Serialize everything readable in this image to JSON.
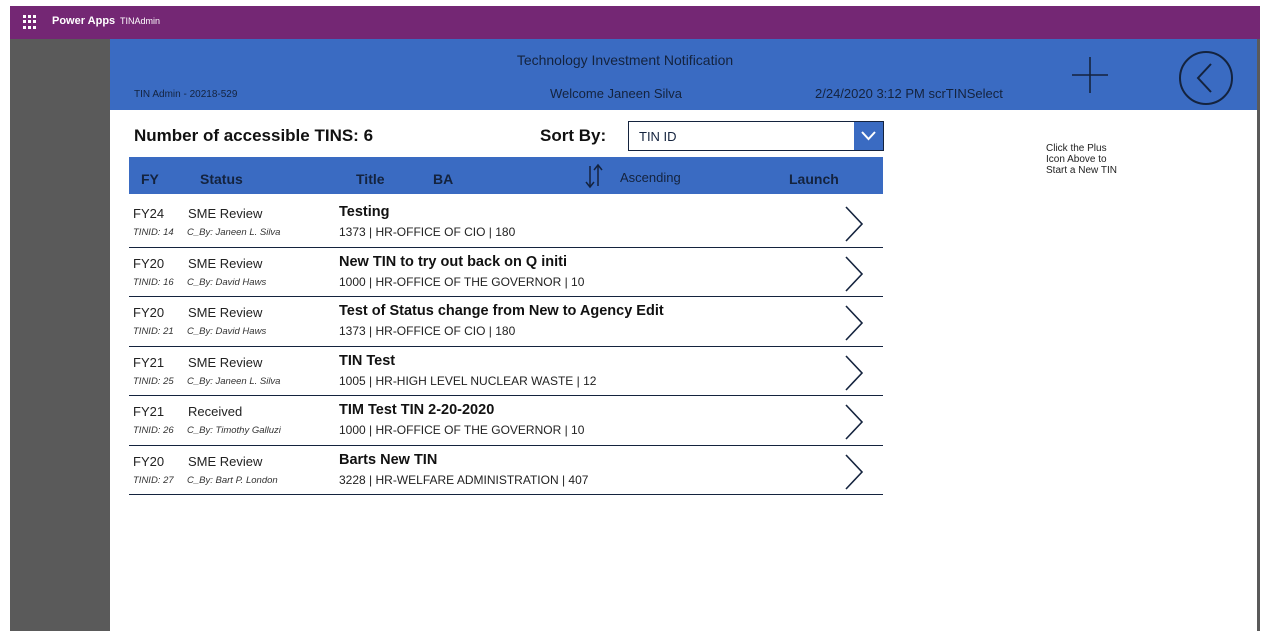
{
  "topbar": {
    "brand": "Power Apps",
    "app_name": "TINAdmin",
    "background": "#742774"
  },
  "header": {
    "title": "Technology Investment Notification",
    "left_text": "TIN Admin - 20218-529",
    "welcome": "Welcome Janeen Silva",
    "datetime_screen": "2/24/2020 3:12 PM  scrTINSelect",
    "add_icon": "plus-icon",
    "back_icon": "back-circle-icon",
    "background": "#3a6bc2"
  },
  "summary": {
    "count_label": "Number of accessible TINS:  6"
  },
  "sort": {
    "label": "Sort By:",
    "selected": "TIN ID",
    "direction": "Ascending"
  },
  "columns": {
    "fy": "FY",
    "status": "Status",
    "title": "Title",
    "ba": "BA",
    "launch": "Launch"
  },
  "rows": [
    {
      "fy": "FY24",
      "status": "SME Review",
      "tinid": "TINID: 14",
      "cby": "C_By: Janeen L. Silva",
      "title": "Testing",
      "sub": "1373 | HR-OFFICE OF CIO | 180"
    },
    {
      "fy": "FY20",
      "status": "SME Review",
      "tinid": "TINID: 16",
      "cby": "C_By: David Haws",
      "title": "New TIN to try out back on Q initi",
      "sub": "1000 | HR-OFFICE OF THE GOVERNOR | 10"
    },
    {
      "fy": "FY20",
      "status": "SME Review",
      "tinid": "TINID: 21",
      "cby": "C_By: David Haws",
      "title": "Test of Status change from New to Agency Edit",
      "sub": "1373 | HR-OFFICE OF CIO | 180"
    },
    {
      "fy": "FY21",
      "status": "SME Review",
      "tinid": "TINID: 25",
      "cby": "C_By: Janeen L. Silva",
      "title": "TIN Test",
      "sub": "1005 | HR-HIGH LEVEL NUCLEAR WASTE | 12"
    },
    {
      "fy": "FY21",
      "status": "Received",
      "tinid": "TINID: 26",
      "cby": "C_By: Timothy Galluzi",
      "title": "TIM Test TIN 2-20-2020",
      "sub": "1000 | HR-OFFICE OF THE GOVERNOR | 10"
    },
    {
      "fy": "FY20",
      "status": "SME Review",
      "tinid": "TINID: 27",
      "cby": "C_By: Bart P. London",
      "title": "Barts New TIN",
      "sub": "3228 | HR-WELFARE ADMINISTRATION | 407"
    }
  ],
  "hint": {
    "line1": "Click the Plus",
    "line2": "Icon Above to",
    "line3": "Start a New TIN"
  }
}
